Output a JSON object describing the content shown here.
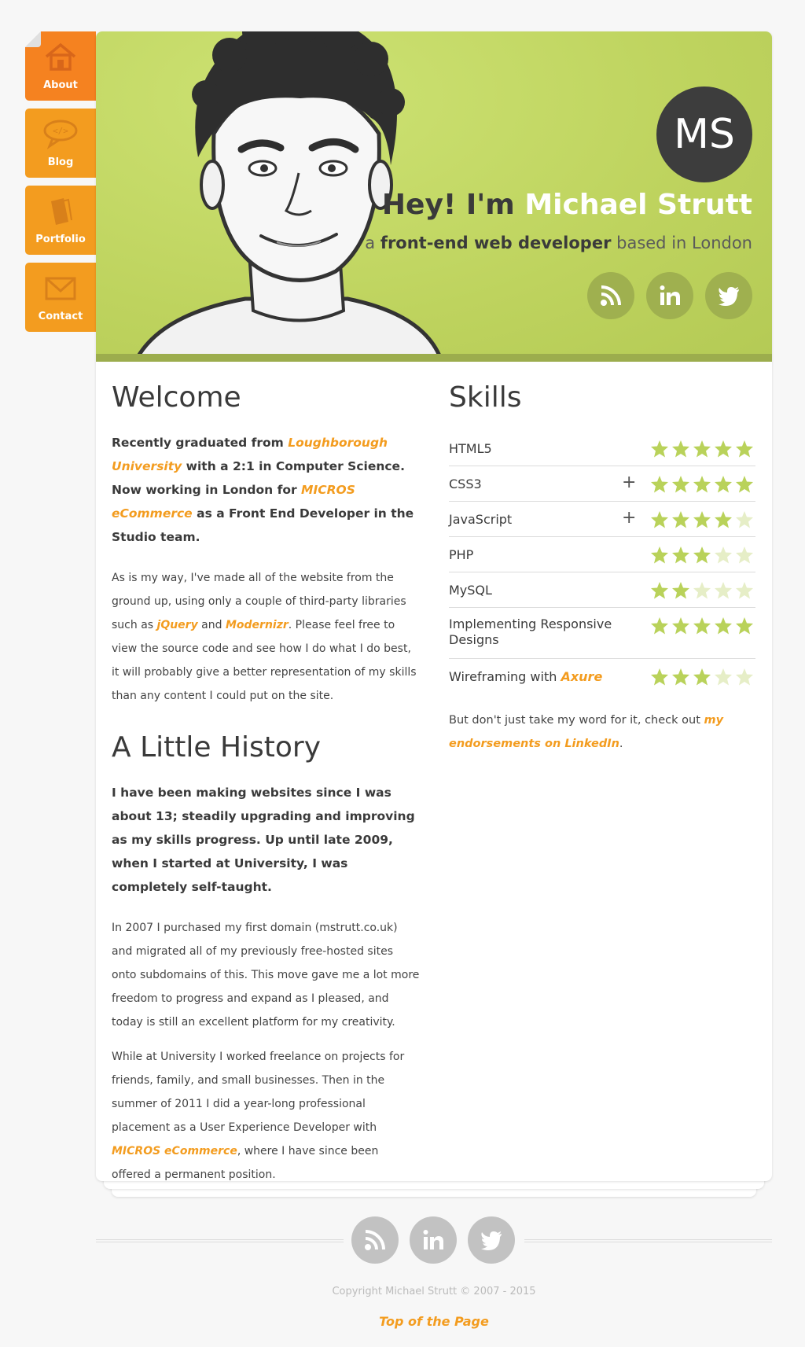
{
  "nav": {
    "items": [
      {
        "label": "About",
        "icon": "house-icon"
      },
      {
        "label": "Blog",
        "icon": "code-bubble-icon"
      },
      {
        "label": "Portfolio",
        "icon": "book-icon"
      },
      {
        "label": "Contact",
        "icon": "envelope-icon"
      }
    ]
  },
  "hero": {
    "monogram": "MS",
    "greeting_prefix": "Hey! I'm",
    "name": "Michael Strutt",
    "tagline_prefix": "a",
    "tagline_role": "front-end web developer",
    "tagline_suffix": "based in London",
    "social": [
      "rss-icon",
      "linkedin-icon",
      "twitter-icon"
    ]
  },
  "welcome": {
    "title": "Welcome",
    "lead_1": "Recently graduated from",
    "lead_link_1": "Loughborough University",
    "lead_2": "with a 2:1 in Computer Science. Now working in London for",
    "lead_link_2": "MICROS eCommerce",
    "lead_3": "as a Front End Developer in the Studio team.",
    "body_1": "As is my way, I've made all of the website from the ground up, using only a couple of third-party libraries such as",
    "body_link_1": "jQuery",
    "body_and": "and",
    "body_link_2": "Modernizr",
    "body_2": ". Please feel free to view the source code and see how I do what I do best, it will probably give a better representation of my skills than any content I could put on the site."
  },
  "history": {
    "title": "A Little History",
    "lead": "I have been making websites since I was about 13; steadily upgrading and improving as my skills progress. Up until late 2009, when I started at University, I was completely self-taught.",
    "para_1": "In 2007 I purchased my first domain (mstrutt.co.uk) and migrated all of my previously free-hosted sites onto subdomains of this. This move gave me a lot more freedom to progress and expand as I pleased, and today is still an excellent platform for my creativity.",
    "para_2_a": "While at University I worked freelance on projects for friends, family, and small businesses. Then in the summer of 2011 I did a year-long professional placement as a User Experience Developer with",
    "para_2_link": "MICROS eCommerce",
    "para_2_b": ", where I have since been offered a permanent position."
  },
  "skills": {
    "title": "Skills",
    "items": [
      {
        "name": "HTML5",
        "rating": 5,
        "expandable": false
      },
      {
        "name": "CSS3",
        "rating": 5,
        "expandable": true
      },
      {
        "name": "JavaScript",
        "rating": 4,
        "expandable": true
      },
      {
        "name": "PHP",
        "rating": 3,
        "expandable": false
      },
      {
        "name": "MySQL",
        "rating": 2,
        "expandable": false
      },
      {
        "name": "Implementing Responsive Designs",
        "rating": 5,
        "expandable": false
      },
      {
        "name": "Wireframing with",
        "link": "Axure",
        "rating": 3,
        "expandable": false
      }
    ],
    "plus_symbol": "+",
    "endorse_text": "But don't just take my word for it, check out",
    "endorse_link": "my endorsements on LinkedIn",
    "endorse_end": "."
  },
  "footer": {
    "social": [
      "rss-icon",
      "linkedin-icon",
      "twitter-icon"
    ],
    "copyright": "Copyright Michael Strutt © 2007 - 2015",
    "top_link": "Top of the Page"
  },
  "colors": {
    "accent_orange": "#f39c1f",
    "nav_active": "#f58220",
    "hero_green": "#bed35e",
    "star_full": "#b9d25a",
    "star_empty": "#e6eec7"
  }
}
